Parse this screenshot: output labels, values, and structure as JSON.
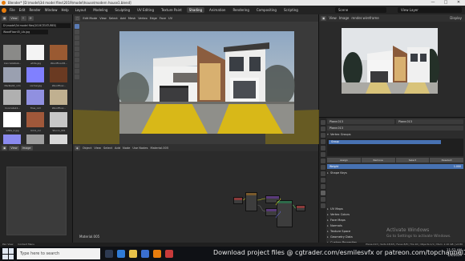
{
  "title_bar": {
    "title": "Blender* [D:\\model\\3d model files\\2019\\model\\house\\modern house1.blend]"
  },
  "window_controls": {
    "min": "—",
    "max": "□",
    "close": "✕"
  },
  "menu": {
    "items": [
      "File",
      "Edit",
      "Render",
      "Window",
      "Help"
    ]
  },
  "workspaces": [
    "Layout",
    "Modeling",
    "Sculpting",
    "UV Editing",
    "Texture Paint",
    "Shading",
    "Animation",
    "Rendering",
    "Compositing",
    "Scripting"
  ],
  "active_workspace": "Shading",
  "scene_field": "Scene",
  "view_layer_field": "View Layer",
  "file_browser": {
    "view_label": "View",
    "path": "D:\\model\\3d model files\\2019\\TEXTURES\\",
    "selected_file": "WoodFloor45_Lib.jpg",
    "thumbnails": [
      {
        "name": "ConcreteSlab...",
        "color": "#8a8a88"
      },
      {
        "name": "white.jpg",
        "color": "#f4f4f4"
      },
      {
        "name": "WoodFloor45...",
        "color": "#9a5a32"
      },
      {
        "name": "Marble02_nrm",
        "color": "#9aa0b0"
      },
      {
        "name": "normal.jpg",
        "color": "#8080ff"
      },
      {
        "name": "WoodFloor...",
        "color": "#6a3a22"
      },
      {
        "name": "Concrete12...",
        "color": "#b0b0b0"
      },
      {
        "name": "Tiles_nrm",
        "color": "#9090e0"
      },
      {
        "name": "WoodFloor...",
        "color": "#c0b090"
      },
      {
        "name": "white_2.jpg",
        "color": "#ffffff"
      },
      {
        "name": "brick_col",
        "color": "#a0583a"
      },
      {
        "name": "Stucco_001",
        "color": "#c7c7c7"
      },
      {
        "name": "Tile_nrm",
        "color": "#8a8aef"
      },
      {
        "name": "Plaster_01",
        "color": "#9e9e9e"
      },
      {
        "name": "Noise_bw",
        "color": "#d8d8d8"
      }
    ]
  },
  "viewport": {
    "header_items": [
      "Edit Mode",
      "View",
      "Select",
      "Add",
      "Mesh",
      "Vertex",
      "Edge",
      "Face",
      "UV"
    ],
    "tools": 10
  },
  "image_editor": {
    "view_label": "View",
    "image_label": "Image"
  },
  "node_editor": {
    "header_items": [
      "Object",
      "View",
      "Select",
      "Add",
      "Node",
      "Use Nodes",
      "Material.005"
    ],
    "material_label": "Material.005"
  },
  "right_panel": {
    "header_items": [
      "View",
      "Image",
      "Image",
      "render.wireframe"
    ],
    "display_label": "Display",
    "object_field_1": "Plane.013",
    "object_field_2": "Plane.013",
    "mesh_name": "Plane.013",
    "sections": {
      "vertex_groups": "Vertex Groups",
      "shape_keys": "Shape Keys",
      "uv_maps": "UV Maps",
      "vertex_colors": "Vertex Colors",
      "face_maps": "Face Maps",
      "normals": "Normals",
      "texture_space": "Texture Space",
      "geometry_data": "Geometry Data",
      "custom_properties": "Custom Properties"
    },
    "vertex_group_name": "Group",
    "vg_buttons": [
      "Assign",
      "Remove",
      "Select",
      "Deselect"
    ],
    "weight_label": "Weight",
    "weight_value": "1.000"
  },
  "status": {
    "left": "Pan View",
    "middle": "Context Menu",
    "right": "Plane.013 | Verts:18/18 | Faces:8/8 | Tris:16 | Objects:1/1 | Mem: 2.10 GB | v2.80"
  },
  "watermark": {
    "line1": "Activate Windows",
    "line2": "Go to Settings to activate Windows."
  },
  "taskbar": {
    "search_placeholder": "Type here to search",
    "promo": "Download project files @ cgtrader.com/esmilesvfx or patreon.com/topchannel1on1",
    "time": "11:52 AM",
    "date": "1/9/2019"
  }
}
